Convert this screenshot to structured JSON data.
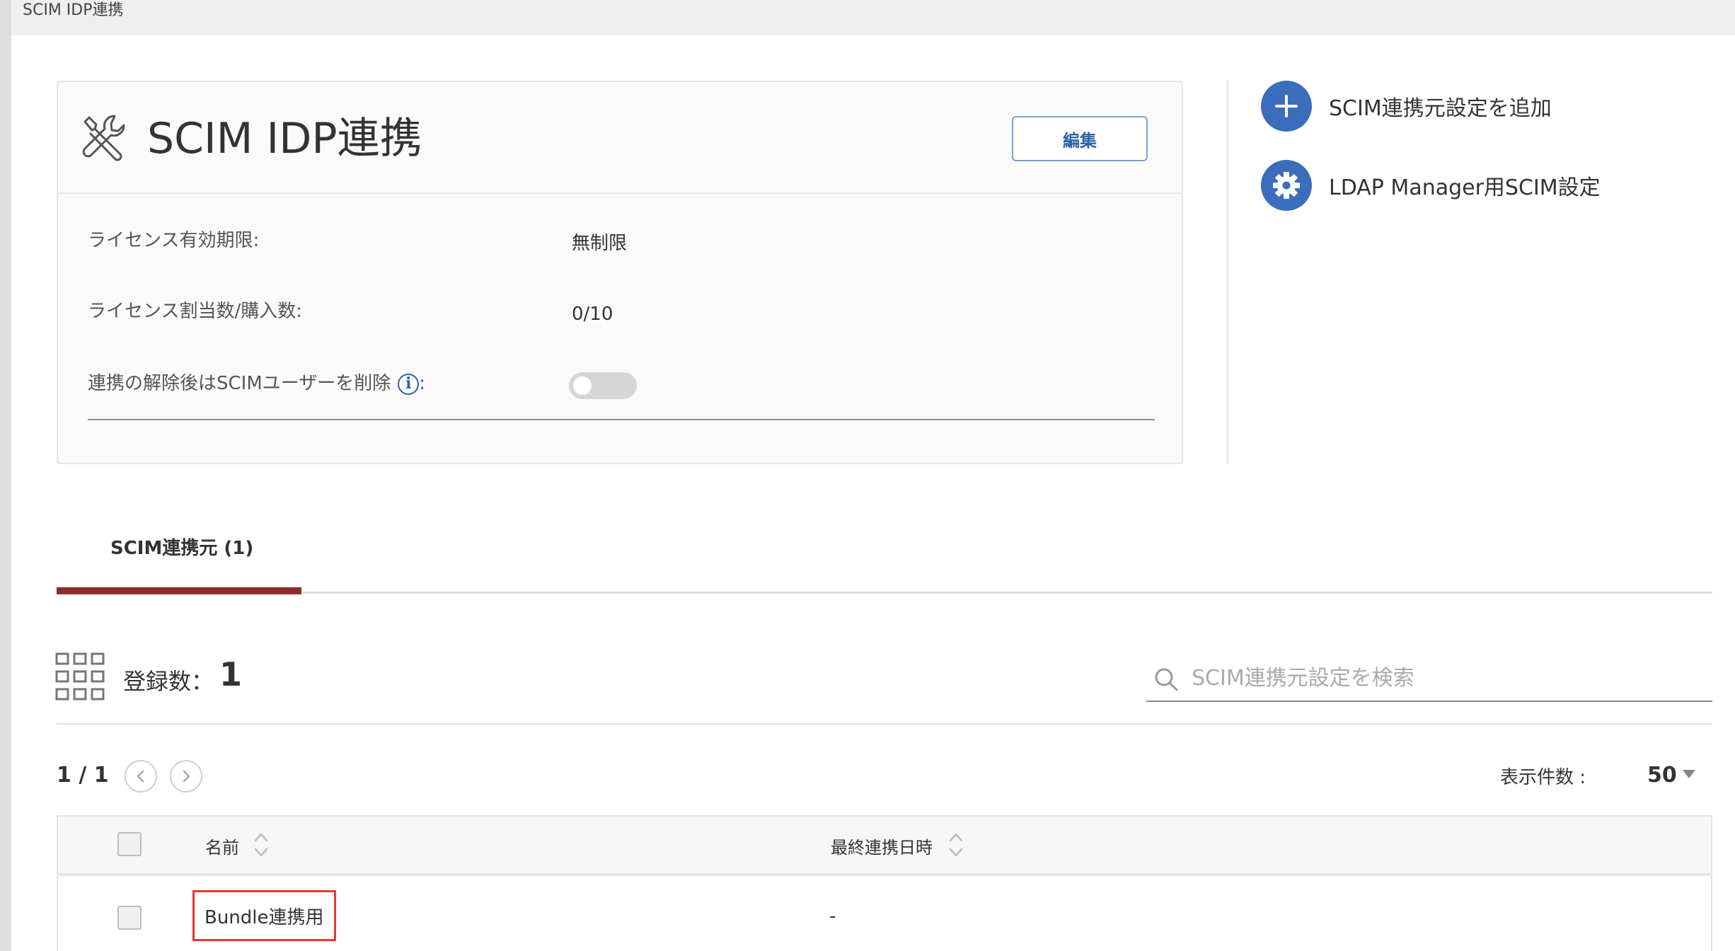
{
  "breadcrumb": "SCIM IDP連携",
  "card": {
    "title": "SCIM IDP連携",
    "edit_label": "編集",
    "rows": [
      {
        "label": "ライセンス有効期限:",
        "value": "無制限"
      },
      {
        "label": "ライセンス割当数/購入数:",
        "value": "0/10"
      }
    ],
    "delete_toggle_label": "連携の解除後はSCIMユーザーを削除",
    "delete_toggle_suffix": ":",
    "info_glyph": "i",
    "delete_toggle_on": false
  },
  "actions": [
    {
      "label": "SCIM連携元設定を追加",
      "icon": "plus-icon"
    },
    {
      "label": "LDAP Manager用SCIM設定",
      "icon": "gear-icon"
    }
  ],
  "tabs": [
    {
      "label": "SCIM連携元 (1)",
      "active": true
    }
  ],
  "registry": {
    "count_label": "登録数：",
    "count_value": "1"
  },
  "search": {
    "placeholder": "SCIM連携元設定を検索",
    "value": ""
  },
  "pagination": {
    "page_text": "1 / 1",
    "per_page_label": "表示件数 :",
    "per_page_value": "50"
  },
  "table": {
    "columns": [
      "名前",
      "最終連携日時"
    ],
    "rows": [
      {
        "name": "Bundle連携用",
        "last_sync": "-"
      }
    ]
  },
  "colors": {
    "accent_blue": "#3b6dbd",
    "tab_active": "#8b2e2e",
    "highlight_border": "#e53a2b"
  }
}
